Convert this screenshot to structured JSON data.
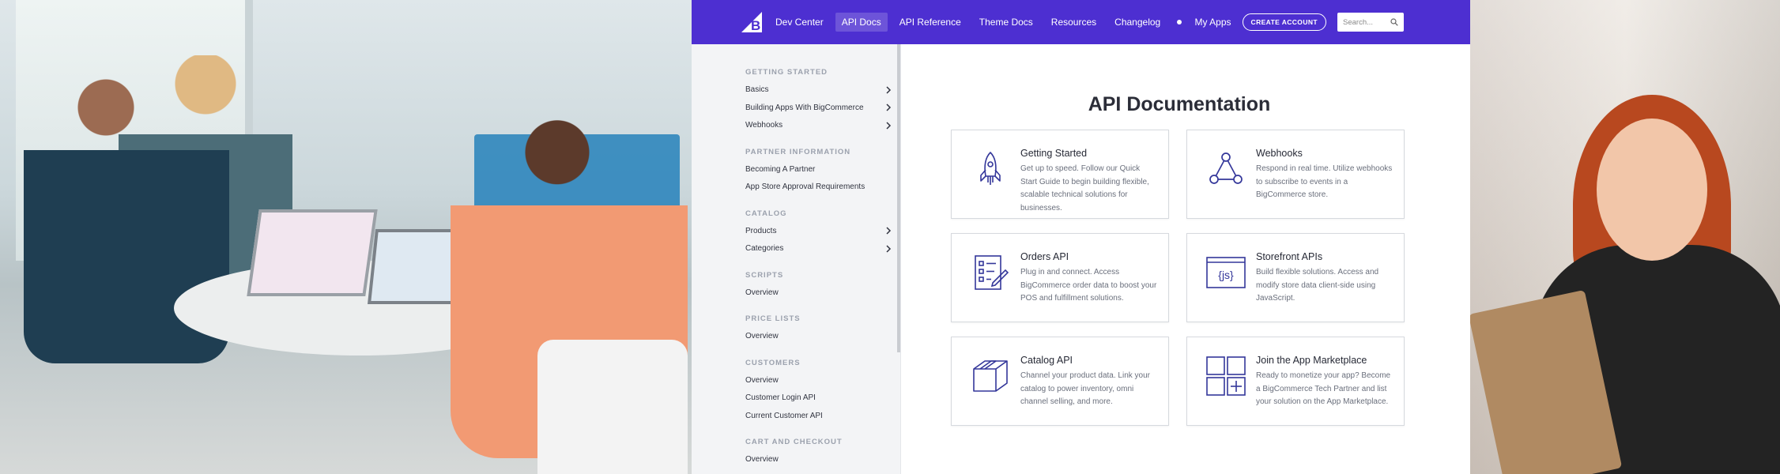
{
  "nav": {
    "brand": "BigCommerce",
    "links": [
      "Dev Center",
      "API Docs",
      "API Reference",
      "Theme Docs",
      "Resources",
      "Changelog"
    ],
    "active_index": 1,
    "my_apps": "My Apps",
    "create_account": "CREATE ACCOUNT",
    "search_placeholder": "Search..."
  },
  "sidebar": {
    "sections": [
      {
        "title": "GETTING STARTED",
        "items": [
          {
            "label": "Basics",
            "expandable": true
          },
          {
            "label": "Building Apps With BigCommerce",
            "expandable": true
          },
          {
            "label": "Webhooks",
            "expandable": true
          }
        ]
      },
      {
        "title": "PARTNER INFORMATION",
        "items": [
          {
            "label": "Becoming A Partner",
            "expandable": false
          },
          {
            "label": "App Store Approval Requirements",
            "expandable": false
          }
        ]
      },
      {
        "title": "CATALOG",
        "items": [
          {
            "label": "Products",
            "expandable": true
          },
          {
            "label": "Categories",
            "expandable": true
          }
        ]
      },
      {
        "title": "SCRIPTS",
        "items": [
          {
            "label": "Overview",
            "expandable": false
          }
        ]
      },
      {
        "title": "PRICE LISTS",
        "items": [
          {
            "label": "Overview",
            "expandable": false
          }
        ]
      },
      {
        "title": "CUSTOMERS",
        "items": [
          {
            "label": "Overview",
            "expandable": false
          },
          {
            "label": "Customer Login API",
            "expandable": false
          },
          {
            "label": "Current Customer API",
            "expandable": false
          }
        ]
      },
      {
        "title": "CART AND CHECKOUT",
        "items": [
          {
            "label": "Overview",
            "expandable": false
          }
        ]
      }
    ]
  },
  "main": {
    "title": "API Documentation",
    "cards": [
      {
        "icon": "rocket-icon",
        "title": "Getting Started",
        "desc": "Get up to speed. Follow our Quick Start Guide to begin building flexible, scalable technical solutions for businesses."
      },
      {
        "icon": "webhooks-icon",
        "title": "Webhooks",
        "desc": "Respond in real time. Utilize webhooks to subscribe to events in a BigCommerce store."
      },
      {
        "icon": "orders-icon",
        "title": "Orders API",
        "desc": "Plug in and connect. Access BigCommerce order data to boost your POS and fulfillment solutions."
      },
      {
        "icon": "storefront-js-icon",
        "title": "Storefront APIs",
        "desc": "Build flexible solutions. Access and modify store data client-side using JavaScript."
      },
      {
        "icon": "catalog-box-icon",
        "title": "Catalog API",
        "desc": "Channel your product data. Link your catalog to power inventory, omni channel selling, and more."
      },
      {
        "icon": "app-marketplace-icon",
        "title": "Join the App Marketplace",
        "desc": "Ready to monetize your app? Become a BigCommerce Tech Partner and list your solution on the App Marketplace."
      }
    ]
  },
  "colors": {
    "nav_bg": "#4d2fd1",
    "icon_stroke": "#34379a"
  }
}
